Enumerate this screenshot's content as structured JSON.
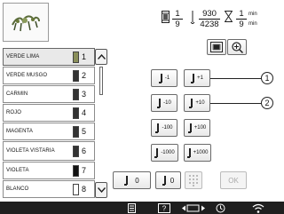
{
  "info": {
    "stitch_current": "1",
    "stitch_total": "9",
    "count_current": "930",
    "count_total": "4238",
    "time_current": "1",
    "time_current_unit": "min",
    "time_total": "9",
    "time_total_unit": "min"
  },
  "threads": [
    {
      "name": "VERDE LIMA",
      "num": "1",
      "color": "#8a8f5a",
      "selected": true
    },
    {
      "name": "VERDE MUSGO",
      "num": "2",
      "color": "#333333"
    },
    {
      "name": "CARMIN",
      "num": "3",
      "color": "#333333"
    },
    {
      "name": "ROJO",
      "num": "4",
      "color": "#333333"
    },
    {
      "name": "MAGENTA",
      "num": "5",
      "color": "#333333"
    },
    {
      "name": "VIOLETA VISTARIA",
      "num": "6",
      "color": "#333333"
    },
    {
      "name": "VIOLETA",
      "num": "7",
      "color": "#111111"
    },
    {
      "name": "BLANCO",
      "num": "8",
      "color": "#ffffff"
    }
  ],
  "controls": {
    "minus1": "-1",
    "plus1": "+1",
    "minus10": "-10",
    "plus10": "+10",
    "minus100": "-100",
    "plus100": "+100",
    "minus1000": "-1000",
    "plus1000": "+1000",
    "begin_value": "0",
    "end_value": "0",
    "ok": "OK"
  },
  "callouts": {
    "one": "1",
    "two": "2"
  }
}
